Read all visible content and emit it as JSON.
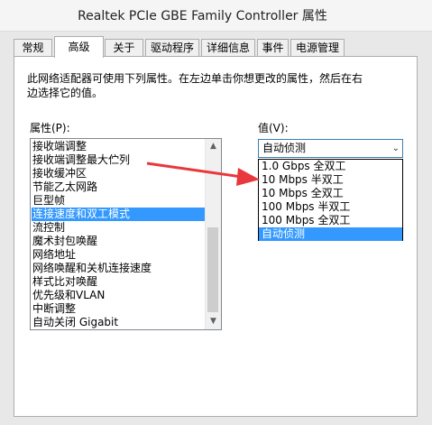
{
  "window": {
    "title": "Realtek PCIe GBE Family Controller 属性",
    "close_glyph": "✕"
  },
  "tabs": [
    {
      "label": "常规",
      "active": false
    },
    {
      "label": "高级",
      "active": true
    },
    {
      "label": "关于",
      "active": false
    },
    {
      "label": "驱动程序",
      "active": false
    },
    {
      "label": "详细信息",
      "active": false
    },
    {
      "label": "事件",
      "active": false
    },
    {
      "label": "电源管理",
      "active": false
    }
  ],
  "advanced": {
    "description_line1": "此网络适配器可使用下列属性。在左边单击你想更改的属性，然后在右",
    "description_line2": "边选择它的值。",
    "property_label": "属性(P):",
    "value_label": "值(V):",
    "properties": [
      "接收端调整",
      "接收端调整最大伫列",
      "接收缓冲区",
      "节能乙太网路",
      "巨型帧",
      "连接速度和双工模式",
      "流控制",
      "魔术封包唤醒",
      "网络地址",
      "网络唤醒和关机连接速度",
      "样式比对唤醒",
      "优先级和VLAN",
      "中断调整",
      "自动关闭 Gigabit"
    ],
    "selected_property_index": 5,
    "selected_value": "自动侦测",
    "value_options": [
      "1.0 Gbps 全双工",
      "10 Mbps 半双工",
      "10 Mbps 全双工",
      "100 Mbps 半双工",
      "100 Mbps 全双工",
      "自动侦测"
    ],
    "selected_option_index": 5
  },
  "icons": {
    "scroll_up": "▲",
    "scroll_down": "▼",
    "dropdown_arrow": "⌄"
  },
  "colors": {
    "selection": "#3399ff",
    "annotation_arrow": "#e8383d"
  }
}
